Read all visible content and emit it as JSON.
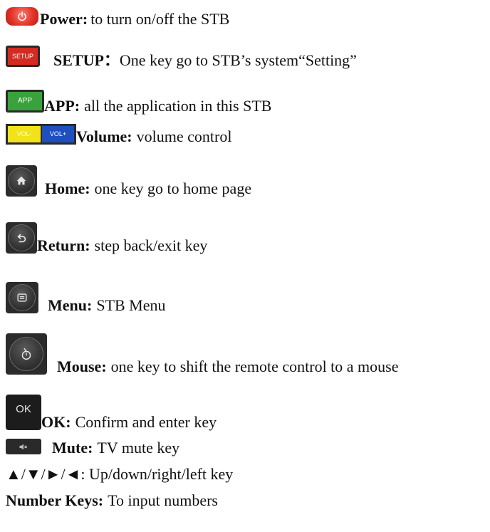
{
  "items": [
    {
      "button_label": "",
      "term": "Power:",
      "description": "to turn on/off the STB"
    },
    {
      "button_label": "SETUP",
      "term": "SETUP：",
      "description": "One key go to STB’s system“Setting”"
    },
    {
      "button_label": "APP",
      "term": "APP:",
      "description": "all the application in this STB"
    },
    {
      "button_labels": [
        "VOL-",
        "VOL+"
      ],
      "term": "Volume:",
      "description": "volume control"
    },
    {
      "term": "Home:",
      "description": "one key go to home page"
    },
    {
      "term": "Return:",
      "description": "step back/exit key"
    },
    {
      "term": "Menu:",
      "description": "STB Menu"
    },
    {
      "term": "Mouse:",
      "description": "one key to shift the remote control to a mouse"
    },
    {
      "button_label": "OK",
      "term": "OK:",
      "description": "Confirm and enter key"
    },
    {
      "term": "Mute:",
      "description": "TV mute key"
    },
    {
      "text": "▲/▼/►/◄: Up/down/right/left key"
    },
    {
      "term": "Number Keys:",
      "description": "To input numbers"
    }
  ],
  "icons": {
    "power": "power-icon",
    "home": "home-icon",
    "return": "return-icon",
    "menu": "menu-icon",
    "mouse": "mouse-icon",
    "mute": "mute-icon"
  },
  "colors": {
    "power": "#e3352a",
    "setup": "#d42a22",
    "app": "#3aa23c",
    "vol_minus": "#f2e21a",
    "vol_plus": "#1f4fbf",
    "dark_button": "#2b2b2b"
  }
}
